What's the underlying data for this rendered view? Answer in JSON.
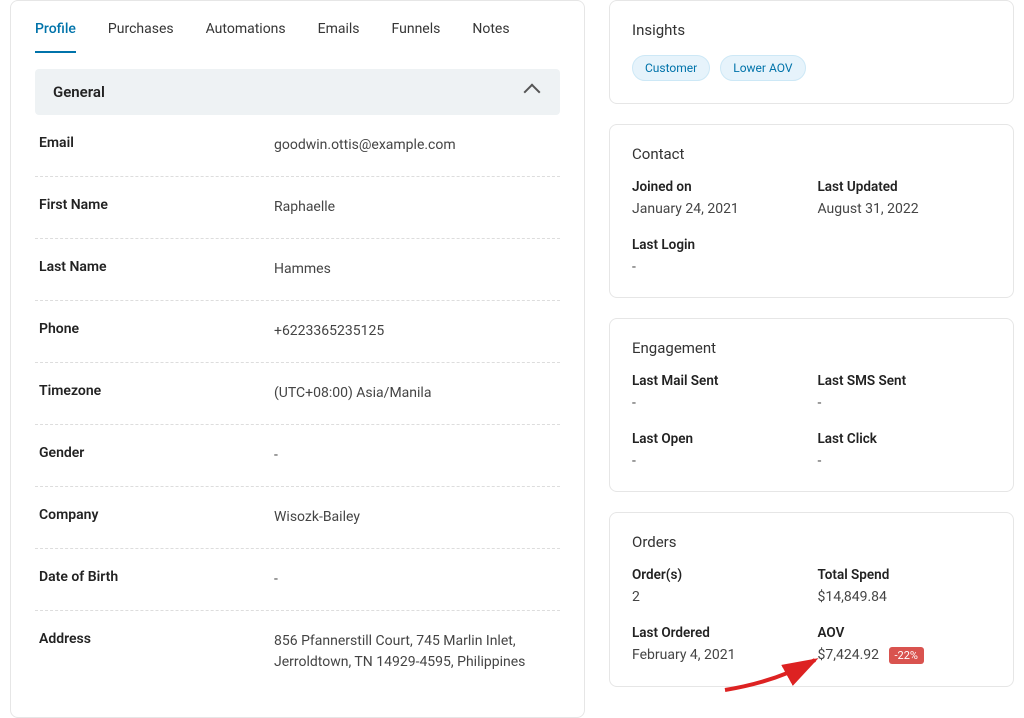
{
  "tabs": [
    "Profile",
    "Purchases",
    "Automations",
    "Emails",
    "Funnels",
    "Notes"
  ],
  "activeTab": 0,
  "general": {
    "title": "General",
    "fields": [
      {
        "label": "Email",
        "value": "goodwin.ottis@example.com"
      },
      {
        "label": "First Name",
        "value": "Raphaelle"
      },
      {
        "label": "Last Name",
        "value": "Hammes"
      },
      {
        "label": "Phone",
        "value": "+6223365235125"
      },
      {
        "label": "Timezone",
        "value": "(UTC+08:00) Asia/Manila"
      },
      {
        "label": "Gender",
        "value": "-"
      },
      {
        "label": "Company",
        "value": "Wisozk-Bailey"
      },
      {
        "label": "Date of Birth",
        "value": "-"
      },
      {
        "label": "Address",
        "value": "856 Pfannerstill Court, 745 Marlin Inlet, Jerroldtown, TN 14929-4595, Philippines"
      }
    ]
  },
  "insights": {
    "title": "Insights",
    "tags": [
      "Customer",
      "Lower AOV"
    ]
  },
  "contact": {
    "title": "Contact",
    "joined_label": "Joined on",
    "joined_value": "January 24, 2021",
    "updated_label": "Last Updated",
    "updated_value": "August 31, 2022",
    "lastlogin_label": "Last Login",
    "lastlogin_value": "-"
  },
  "engagement": {
    "title": "Engagement",
    "mail_label": "Last Mail Sent",
    "mail_value": "-",
    "sms_label": "Last SMS Sent",
    "sms_value": "-",
    "open_label": "Last Open",
    "open_value": "-",
    "click_label": "Last Click",
    "click_value": "-"
  },
  "orders": {
    "title": "Orders",
    "orders_label": "Order(s)",
    "orders_value": "2",
    "spend_label": "Total Spend",
    "spend_value": "$14,849.84",
    "last_label": "Last Ordered",
    "last_value": "February 4, 2021",
    "aov_label": "AOV",
    "aov_value": "$7,424.92",
    "aov_badge": "-22%"
  }
}
